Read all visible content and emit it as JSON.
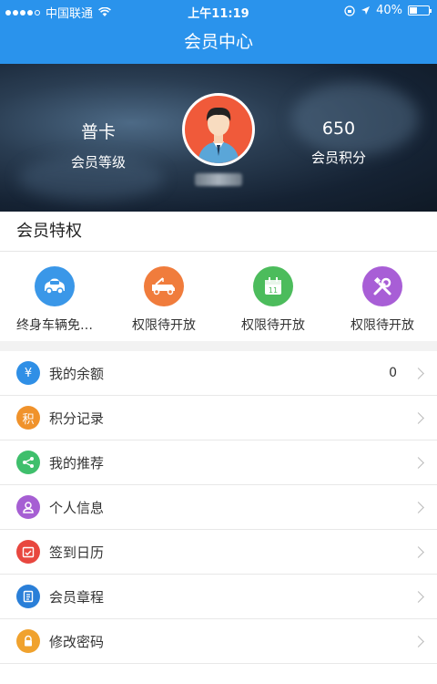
{
  "status_bar": {
    "carrier": "中国联通",
    "time": "上午11:19",
    "battery": "40%",
    "battery_level": 0.4
  },
  "nav": {
    "title": "会员中心"
  },
  "profile": {
    "level_value": "普卡",
    "level_label": "会员等级",
    "points_value": "650",
    "points_label": "会员积分"
  },
  "privileges": {
    "title": "会员特权",
    "items": [
      {
        "label": "终身车辆免…",
        "icon": "car-icon",
        "color": "#3a97e8"
      },
      {
        "label": "权限待开放",
        "icon": "tow-truck-icon",
        "color": "#f07c3c"
      },
      {
        "label": "权限待开放",
        "icon": "calendar-icon",
        "color": "#4cbc5c"
      },
      {
        "label": "权限待开放",
        "icon": "tools-icon",
        "color": "#a85ed6"
      }
    ]
  },
  "menu": {
    "items": [
      {
        "label": "我的余额",
        "value": "0",
        "icon": "yen-icon",
        "glyph": "¥",
        "color": "#2f8fe6"
      },
      {
        "label": "积分记录",
        "value": "",
        "icon": "points-icon",
        "glyph": "积",
        "color": "#f0922b"
      },
      {
        "label": "我的推荐",
        "value": "",
        "icon": "share-icon",
        "glyph": "",
        "color": "#3fbf6c"
      },
      {
        "label": "个人信息",
        "value": "",
        "icon": "person-icon",
        "glyph": "",
        "color": "#a65fd3"
      },
      {
        "label": "签到日历",
        "value": "",
        "icon": "checkin-calendar-icon",
        "glyph": "",
        "color": "#e8473f"
      },
      {
        "label": "会员章程",
        "value": "",
        "icon": "document-icon",
        "glyph": "",
        "color": "#2a7fd8"
      },
      {
        "label": "修改密码",
        "value": "",
        "icon": "lock-icon",
        "glyph": "",
        "color": "#f0a22e"
      }
    ]
  }
}
